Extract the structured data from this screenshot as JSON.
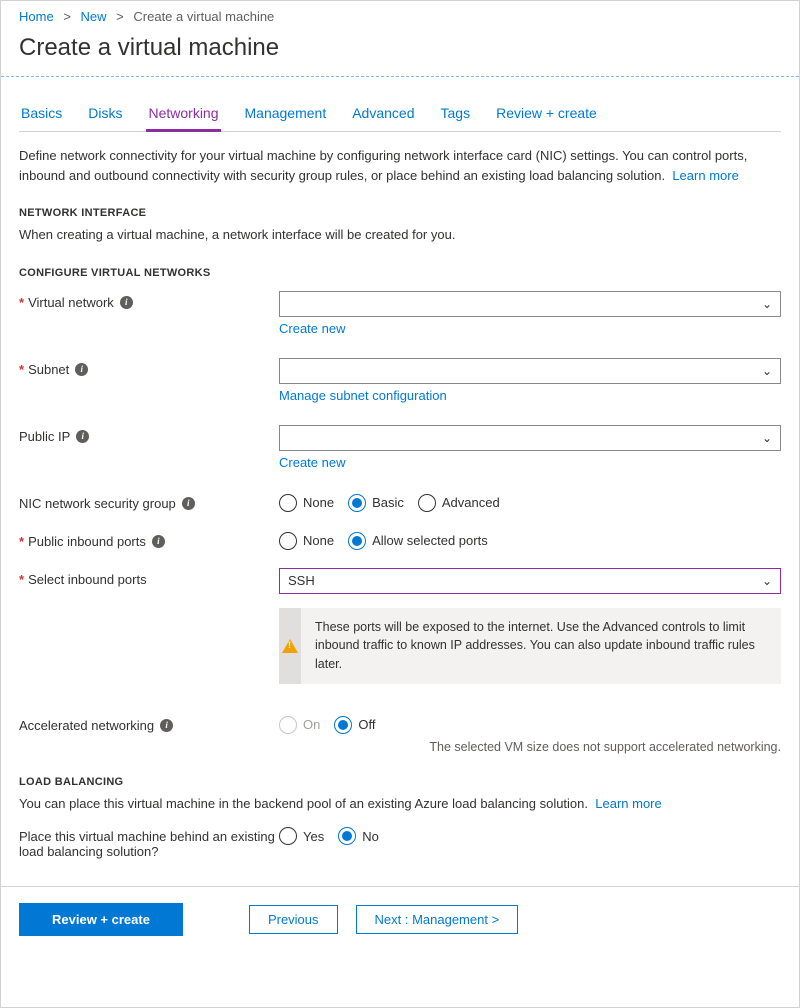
{
  "breadcrumb": {
    "home": "Home",
    "new": "New",
    "current": "Create a virtual machine"
  },
  "title": "Create a virtual machine",
  "tabs": [
    {
      "label": "Basics"
    },
    {
      "label": "Disks"
    },
    {
      "label": "Networking",
      "active": true
    },
    {
      "label": "Management"
    },
    {
      "label": "Advanced"
    },
    {
      "label": "Tags"
    },
    {
      "label": "Review + create"
    }
  ],
  "intro": "Define network connectivity for your virtual machine by configuring network interface card (NIC) settings. You can control ports, inbound and outbound connectivity with security group rules, or place behind an existing load balancing solution.",
  "learn_more": "Learn more",
  "sections": {
    "network_interface": {
      "head": "NETWORK INTERFACE",
      "desc": "When creating a virtual machine, a network interface will be created for you."
    },
    "configure_vnet": {
      "head": "CONFIGURE VIRTUAL NETWORKS"
    },
    "load_balancing": {
      "head": "LOAD BALANCING",
      "desc": "You can place this virtual machine in the backend pool of an existing Azure load balancing solution."
    }
  },
  "fields": {
    "vnet": {
      "label": "Virtual network",
      "value": "",
      "sublink": "Create new"
    },
    "subnet": {
      "label": "Subnet",
      "value": "",
      "sublink": "Manage subnet configuration"
    },
    "public_ip": {
      "label": "Public IP",
      "value": "",
      "sublink": "Create new"
    },
    "nsg": {
      "label": "NIC network security group",
      "options": {
        "none": "None",
        "basic": "Basic",
        "advanced": "Advanced"
      },
      "selected": "basic"
    },
    "inbound": {
      "label": "Public inbound ports",
      "options": {
        "none": "None",
        "allow": "Allow selected ports"
      },
      "selected": "allow"
    },
    "select_ports": {
      "label": "Select inbound ports",
      "value": "SSH"
    },
    "warn": "These ports will be exposed to the internet. Use the Advanced controls to limit inbound traffic to known IP addresses. You can also update inbound traffic rules later.",
    "accel": {
      "label": "Accelerated networking",
      "options": {
        "on": "On",
        "off": "Off"
      },
      "selected": "off",
      "helper": "The selected VM size does not support accelerated networking."
    },
    "lb": {
      "label": "Place this virtual machine behind an existing load balancing solution?",
      "options": {
        "yes": "Yes",
        "no": "No"
      },
      "selected": "no"
    }
  },
  "footer": {
    "review": "Review + create",
    "prev": "Previous",
    "next": "Next : Management  >"
  }
}
